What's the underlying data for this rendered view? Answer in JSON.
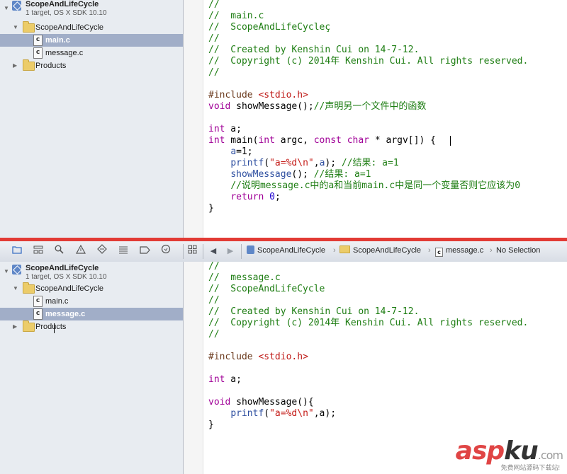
{
  "top_pane": {
    "navigator": {
      "project_name": "ScopeAndLifeCycle",
      "project_sub": "1 target, OS X SDK 10.10",
      "folder": "ScopeAndLifeCycle",
      "files": [
        {
          "label": "main.c",
          "icon_letter": "c",
          "selected": true
        },
        {
          "label": "message.c",
          "icon_letter": "c",
          "selected": false
        }
      ],
      "products": "Products"
    },
    "code_lines": [
      [
        [
          "cm",
          "//"
        ]
      ],
      [
        [
          "cm",
          "//  main.c"
        ]
      ],
      [
        [
          "cm",
          "//  ScopeAndLifeCycleç"
        ]
      ],
      [
        [
          "cm",
          "//"
        ]
      ],
      [
        [
          "cm",
          "//  Created by Kenshin Cui on 14-7-12."
        ]
      ],
      [
        [
          "cm",
          "//  Copyright (c) 2014年 Kenshin Cui. All rights reserved."
        ]
      ],
      [
        [
          "cm",
          "//"
        ]
      ],
      [
        [
          "",
          ""
        ]
      ],
      [
        [
          "pp",
          "#include "
        ],
        [
          "inc",
          "<stdio.h>"
        ]
      ],
      [
        [
          "kw",
          "void"
        ],
        [
          "",
          " showMessage();"
        ],
        [
          "cm",
          "//声明另一个文件中的函数"
        ]
      ],
      [
        [
          "",
          ""
        ]
      ],
      [
        [
          "kw",
          "int"
        ],
        [
          "",
          " a;"
        ]
      ],
      [
        [
          "kw",
          "int"
        ],
        [
          "",
          " main("
        ],
        [
          "kw",
          "int"
        ],
        [
          "",
          " argc, "
        ],
        [
          "kw",
          "const"
        ],
        [
          "",
          " "
        ],
        [
          "kw",
          "char"
        ],
        [
          "",
          " * argv[]) {"
        ]
      ],
      [
        [
          "",
          "    "
        ],
        [
          "fn",
          "a"
        ],
        [
          "",
          "=1;"
        ]
      ],
      [
        [
          "",
          "    "
        ],
        [
          "fn",
          "printf"
        ],
        [
          "",
          "("
        ],
        [
          "str",
          "\"a=%d\\n\""
        ],
        [
          "",
          ","
        ],
        [
          "fn",
          "a"
        ],
        [
          "",
          "); "
        ],
        [
          "cm",
          "//结果: a=1"
        ]
      ],
      [
        [
          "",
          "    "
        ],
        [
          "fn",
          "showMessage"
        ],
        [
          "",
          "(); "
        ],
        [
          "cm",
          "//结果: a=1"
        ]
      ],
      [
        [
          "",
          "    "
        ],
        [
          "cm",
          "//说明message.c中的a和当前main.c中是同一个变量否则它应该为0"
        ]
      ],
      [
        [
          "",
          "    "
        ],
        [
          "kw",
          "return"
        ],
        [
          "",
          " "
        ],
        [
          "num",
          "0"
        ],
        [
          "",
          ";"
        ]
      ],
      [
        [
          "",
          "}"
        ]
      ]
    ]
  },
  "toolbar": {
    "breadcrumbs": {
      "project": "ScopeAndLifeCycle",
      "group": "ScopeAndLifeCycle",
      "file": "message.c",
      "file_letter": "c",
      "selection": "No Selection"
    },
    "icons": [
      "folder-icon",
      "hierarchy-icon",
      "search-icon",
      "warning-icon",
      "diamond-icon",
      "list-icon",
      "tag-icon",
      "chat-icon"
    ]
  },
  "bottom_pane": {
    "navigator": {
      "project_name": "ScopeAndLifeCycle",
      "project_sub": "1 target, OS X SDK 10.10",
      "folder": "ScopeAndLifeCycle",
      "files": [
        {
          "label": "main.c",
          "icon_letter": "c",
          "selected": false
        },
        {
          "label": "message.c",
          "icon_letter": "c",
          "selected": true
        }
      ],
      "products": "Products"
    },
    "code_lines": [
      [
        [
          "cm",
          "//"
        ]
      ],
      [
        [
          "cm",
          "//  message.c"
        ]
      ],
      [
        [
          "cm",
          "//  ScopeAndLifeCycle"
        ]
      ],
      [
        [
          "cm",
          "//"
        ]
      ],
      [
        [
          "cm",
          "//  Created by Kenshin Cui on 14-7-12."
        ]
      ],
      [
        [
          "cm",
          "//  Copyright (c) 2014年 Kenshin Cui. All rights reserved."
        ]
      ],
      [
        [
          "cm",
          "//"
        ]
      ],
      [
        [
          "",
          ""
        ]
      ],
      [
        [
          "pp",
          "#include "
        ],
        [
          "inc",
          "<stdio.h>"
        ]
      ],
      [
        [
          "",
          ""
        ]
      ],
      [
        [
          "kw",
          "int"
        ],
        [
          "",
          " a;"
        ]
      ],
      [
        [
          "",
          ""
        ]
      ],
      [
        [
          "kw",
          "void"
        ],
        [
          "",
          " showMessage(){"
        ]
      ],
      [
        [
          "",
          "    "
        ],
        [
          "fn",
          "printf"
        ],
        [
          "",
          "("
        ],
        [
          "str",
          "\"a=%d\\n\""
        ],
        [
          "",
          ",a);"
        ]
      ],
      [
        [
          "",
          "}"
        ]
      ]
    ]
  },
  "watermark": {
    "brand_asp": "asp",
    "brand_ku": "ku",
    "brand_com": ".com",
    "tagline": "免费网站源码下载站!"
  }
}
